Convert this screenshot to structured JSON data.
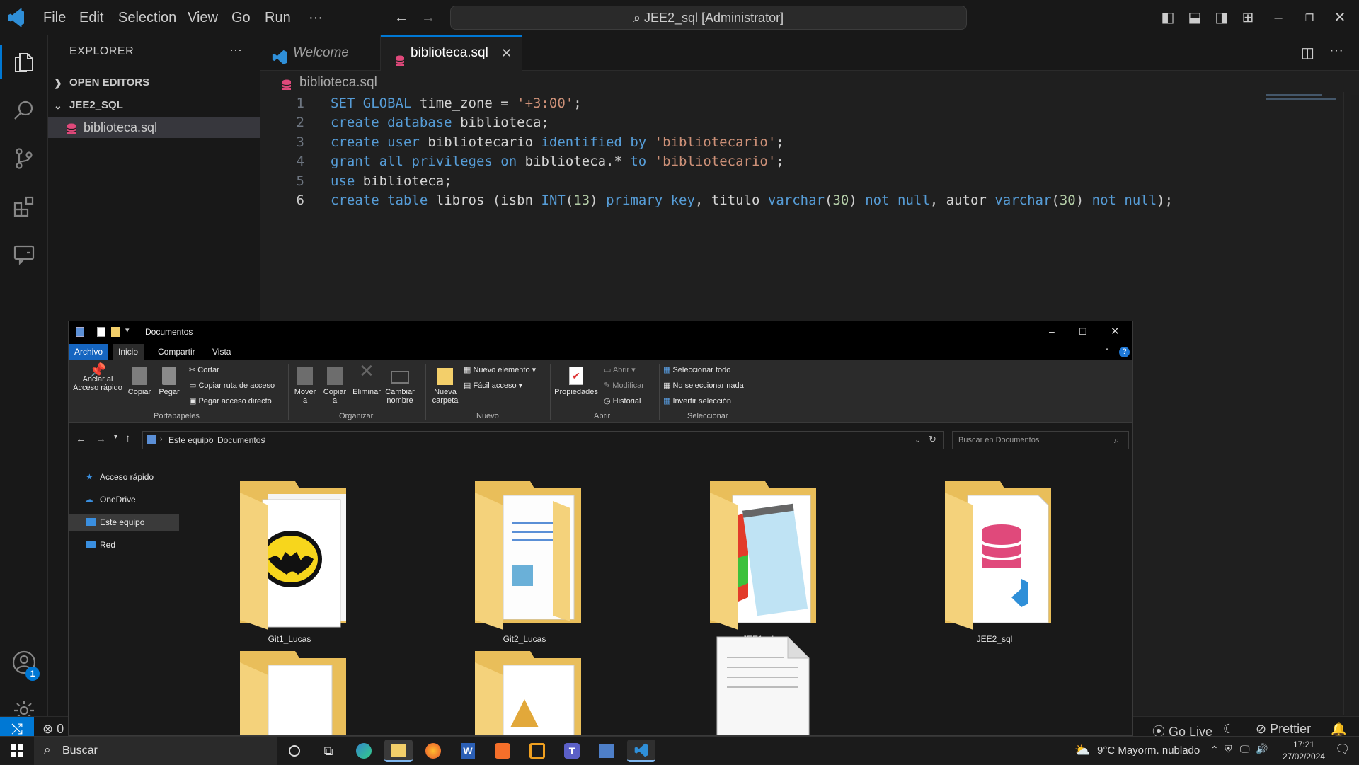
{
  "titlebar": {
    "menu": [
      "File",
      "Edit",
      "Selection",
      "View",
      "Go",
      "Run",
      "···"
    ],
    "command_center": "JEE2_sql [Administrator]"
  },
  "sidebar": {
    "title": "EXPLORER",
    "more": "···",
    "open_editors": "OPEN EDITORS",
    "folder": "JEE2_SQL",
    "file": "biblioteca.sql"
  },
  "tabs": [
    {
      "label": "Welcome",
      "active": false
    },
    {
      "label": "biblioteca.sql",
      "active": true
    }
  ],
  "breadcrumb": "biblioteca.sql",
  "code": {
    "line_numbers": [
      "1",
      "2",
      "3",
      "4",
      "5",
      "6"
    ],
    "lines": [
      "SET GLOBAL time_zone = '+3:00';",
      "create database biblioteca;",
      "create user bibliotecario identified by 'bibliotecario';",
      "grant all privileges on biblioteca.* to 'bibliotecario';",
      "use biblioteca;",
      "create table libros (isbn INT(13) primary key, titulo varchar(30) not null, autor varchar(30) not null);"
    ]
  },
  "accounts_badge": "1",
  "status": {
    "errors": "0",
    "go_live": "Go Live",
    "prettier": "Prettier"
  },
  "explorer": {
    "title": "Documentos",
    "ribbon_tabs": [
      "Archivo",
      "Inicio",
      "Compartir",
      "Vista"
    ],
    "ribbon": {
      "anclar": "Anclar al Acceso rápido",
      "copiar": "Copiar",
      "pegar": "Pegar",
      "cortar": "Cortar",
      "copiar_ruta": "Copiar ruta de acceso",
      "pegar_acceso": "Pegar acceso directo",
      "grp_portapapeles": "Portapapeles",
      "mover": "Mover a",
      "copiar_a": "Copiar a",
      "eliminar": "Eliminar",
      "cambiar": "Cambiar nombre",
      "grp_organizar": "Organizar",
      "nueva_carpeta": "Nueva carpeta",
      "nuevo_elemento": "Nuevo elemento",
      "facil_acceso": "Fácil acceso",
      "grp_nuevo": "Nuevo",
      "propiedades": "Propiedades",
      "abrir": "Abrir",
      "modificar": "Modificar",
      "historial": "Historial",
      "grp_abrir": "Abrir",
      "sel_todo": "Seleccionar todo",
      "sel_nada": "No seleccionar nada",
      "sel_invertir": "Invertir selección",
      "grp_seleccionar": "Seleccionar"
    },
    "address": [
      "Este equipo",
      "Documentos"
    ],
    "search_placeholder": "Buscar en Documentos",
    "nav": [
      "Acceso rápido",
      "OneDrive",
      "Este equipo",
      "Red"
    ],
    "folders": [
      "Git1_Lucas",
      "Git2_Lucas",
      "JEE1_sh",
      "JEE2_sql"
    ]
  },
  "taskbar": {
    "search": "Buscar",
    "weather": "9°C  Mayorm. nublado",
    "time": "17:21",
    "date": "27/02/2024"
  },
  "colors": {
    "accent": "#0078d4",
    "sql_icon": "#e0497b",
    "folder": "#f3cf6a"
  }
}
